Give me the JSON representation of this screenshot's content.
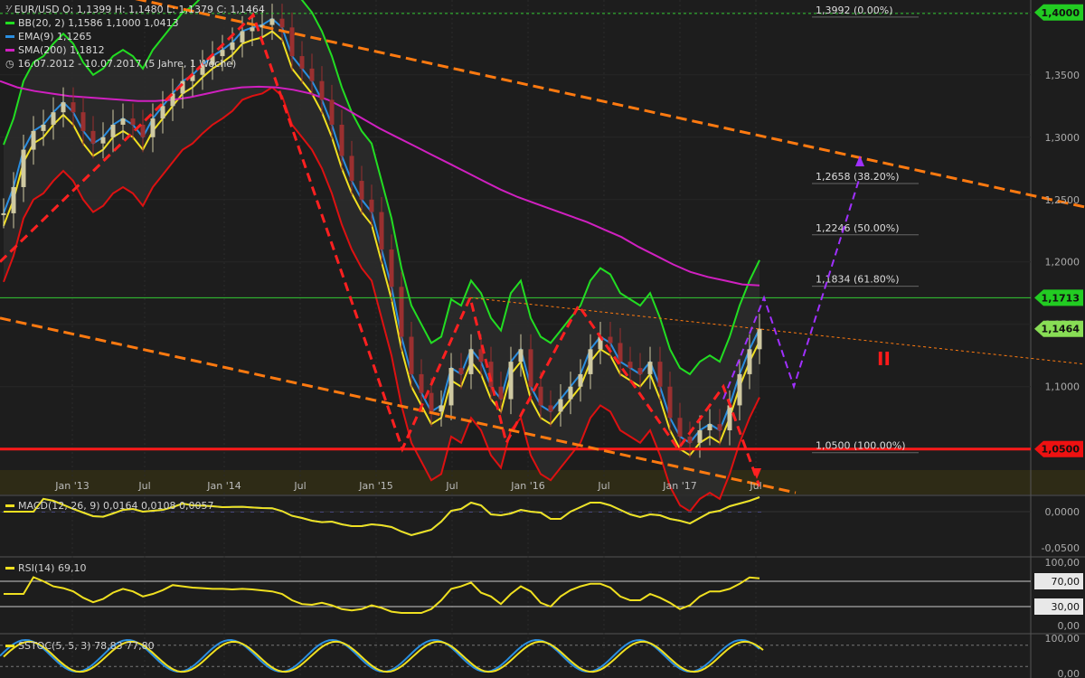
{
  "header": {
    "symbol_line": "EUR/USD  O: 1,1399  H: 1,1480  L: 1,1379  C: 1,1464",
    "bb_line": "BB(20, 2)  1,1586  1,1000  1,0413",
    "ema_line": "EMA(9)  1,1265",
    "sma_line": "SMA(200)  1,1812",
    "period_line": "16.07.2012 - 10.07.2017  (5 Jahre, 1 Woche)"
  },
  "colors": {
    "background": "#1b1b1b",
    "candle_up": "#cfc9a2",
    "candle_down": "#9a3030",
    "bb": "#22dd22",
    "bb_lower": "#dd1111",
    "ema": "#2a8ee0",
    "sma": "#d020c0",
    "yellow": "#f0e020",
    "orange": "#ff7a10",
    "red_level": "#ff1a1a",
    "purple": "#a030ff",
    "green_level": "#33cc33"
  },
  "chart_data": {
    "type": "candlestick",
    "x_ticks": [
      "Jan '13",
      "Jul",
      "Jan '14",
      "Jul",
      "Jan '15",
      "Jul",
      "Jan '16",
      "Jul",
      "Jan '17",
      "Jul"
    ],
    "y_ticks": [
      "1,4000",
      "1,3500",
      "1,3000",
      "1,2500",
      "1,2000",
      "1,1500",
      "1,1000",
      "1,0500"
    ],
    "ylim": [
      1.015,
      1.41
    ],
    "price_labels": [
      {
        "text": "1,4000",
        "value": 1.4,
        "color": "#22cc22"
      },
      {
        "text": "1,1713",
        "value": 1.1713,
        "color": "#22cc22"
      },
      {
        "text": "1,1464",
        "value": 1.1464,
        "color": "#88dd55"
      },
      {
        "text": "1,0500",
        "value": 1.05,
        "color": "#ee1111"
      }
    ],
    "fib_levels": [
      {
        "label": "1,3992 (0.00%)",
        "value": 1.3992
      },
      {
        "label": "1,2658 (38.20%)",
        "value": 1.2658
      },
      {
        "label": "1,2246 (50.00%)",
        "value": 1.2246
      },
      {
        "label": "1,1834 (61.80%)",
        "value": 1.1834
      },
      {
        "label": "1,0500 (100.00%)",
        "value": 1.05
      }
    ],
    "close": [
      1.239,
      1.26,
      1.29,
      1.305,
      1.31,
      1.32,
      1.328,
      1.32,
      1.305,
      1.295,
      1.3,
      1.31,
      1.315,
      1.31,
      1.3,
      1.315,
      1.325,
      1.335,
      1.345,
      1.35,
      1.358,
      1.365,
      1.37,
      1.376,
      1.385,
      1.388,
      1.39,
      1.395,
      1.388,
      1.365,
      1.355,
      1.345,
      1.33,
      1.31,
      1.285,
      1.265,
      1.25,
      1.24,
      1.21,
      1.18,
      1.14,
      1.11,
      1.095,
      1.08,
      1.085,
      1.115,
      1.11,
      1.13,
      1.12,
      1.1,
      1.09,
      1.12,
      1.13,
      1.1,
      1.085,
      1.08,
      1.09,
      1.1,
      1.11,
      1.13,
      1.14,
      1.135,
      1.12,
      1.115,
      1.11,
      1.12,
      1.1,
      1.075,
      1.06,
      1.055,
      1.065,
      1.07,
      1.065,
      1.085,
      1.11,
      1.13,
      1.1464
    ],
    "sma200": [
      1.345,
      1.34,
      1.337,
      1.335,
      1.333,
      1.332,
      1.331,
      1.33,
      1.329,
      1.329,
      1.33,
      1.332,
      1.335,
      1.338,
      1.34,
      1.3405,
      1.34,
      1.338,
      1.335,
      1.33,
      1.323,
      1.315,
      1.307,
      1.3,
      1.293,
      1.286,
      1.279,
      1.272,
      1.265,
      1.258,
      1.252,
      1.247,
      1.242,
      1.237,
      1.232,
      1.226,
      1.22,
      1.212,
      1.205,
      1.198,
      1.192,
      1.188,
      1.185,
      1.182,
      1.1812
    ],
    "macd_labels": "MACD(12, 26, 9)  0,0164  0,0108  0,0057",
    "macd_ticks": [
      "0,0000",
      "-0,0500"
    ],
    "rsi_label": "RSI(14)  69,10",
    "rsi_ticks": [
      "100,00",
      "70,00",
      "30,00",
      "0,00"
    ],
    "stoch_label": "SSTOC(5, 5, 3)  78,83  77,80",
    "stoch_ticks": [
      "100,00",
      "0,00"
    ],
    "annotation_text": "II"
  }
}
